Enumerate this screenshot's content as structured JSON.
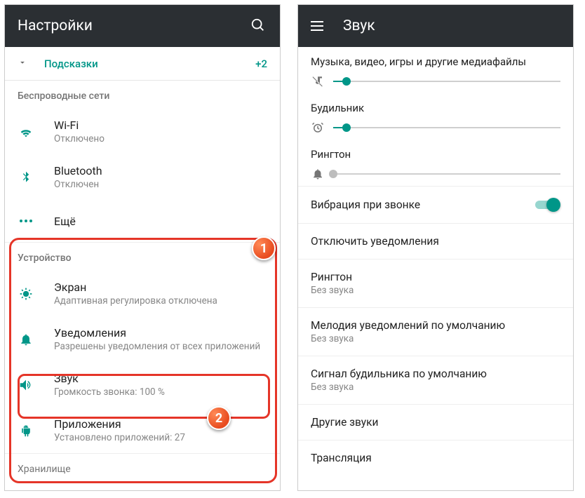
{
  "left": {
    "header": {
      "title": "Настройки"
    },
    "hints": {
      "label": "Подсказки",
      "badge": "+2"
    },
    "section_wireless": "Беспроводные сети",
    "section_device": "Устройство",
    "items": {
      "wifi": {
        "title": "Wi-Fi",
        "subtitle": "Отключено"
      },
      "bluetooth": {
        "title": "Bluetooth",
        "subtitle": "Отключен"
      },
      "more": {
        "title": "Ещё"
      },
      "display": {
        "title": "Экран",
        "subtitle": "Адаптивная регулировка отключена"
      },
      "notifications": {
        "title": "Уведомления",
        "subtitle": "Разрешены уведомления от всех приложений"
      },
      "sound": {
        "title": "Звук",
        "subtitle": "Громкость звонка: 100 %"
      },
      "apps": {
        "title": "Приложения",
        "subtitle": "Установлено приложений: 27"
      },
      "storage_cut": "Хранилище"
    }
  },
  "right": {
    "header": {
      "title": "Звук"
    },
    "sliders": {
      "media": {
        "label": "Музыка, видео, игры и другие медиафайлы",
        "percent": 6
      },
      "alarm": {
        "label": "Будильник",
        "percent": 6
      },
      "ring": {
        "label": "Рингтон",
        "percent": 0
      }
    },
    "items": {
      "vibrate": {
        "title": "Вибрация при звонке"
      },
      "dnd": {
        "title": "Отключить уведомления"
      },
      "ringtone": {
        "title": "Рингтон",
        "sub": "Без звука"
      },
      "notif_sound": {
        "title": "Мелодия уведомлений по умолчанию",
        "sub": "Без звука"
      },
      "alarm_sound": {
        "title": "Сигнал будильника по умолчанию",
        "sub": "Без звука"
      },
      "other": {
        "title": "Другие звуки"
      },
      "cast": {
        "title": "Трансляция"
      }
    }
  },
  "annotations": {
    "b1": "1",
    "b2": "2"
  }
}
